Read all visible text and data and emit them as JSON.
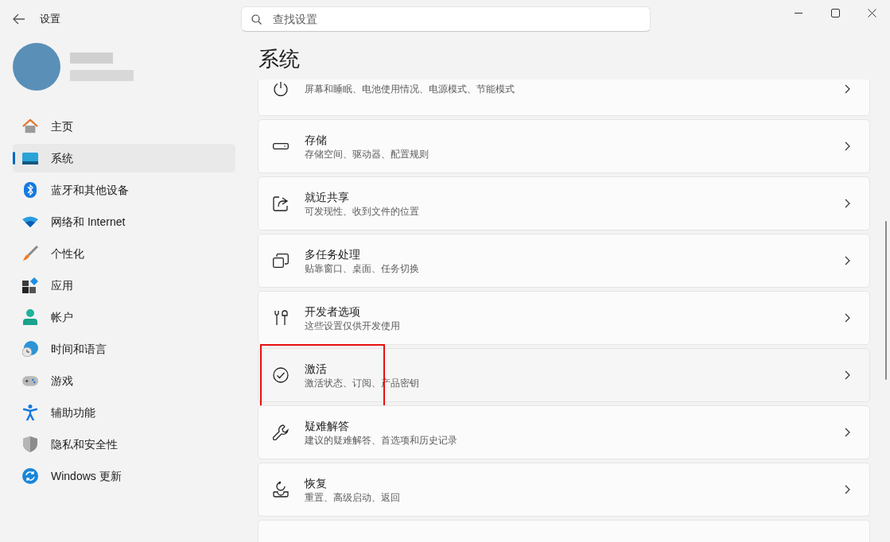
{
  "window": {
    "title": "设置"
  },
  "search": {
    "placeholder": "查找设置"
  },
  "sidebar": {
    "items": [
      {
        "label": "主页",
        "selected": false
      },
      {
        "label": "系统",
        "selected": true
      },
      {
        "label": "蓝牙和其他设备",
        "selected": false
      },
      {
        "label": "网络和 Internet",
        "selected": false
      },
      {
        "label": "个性化",
        "selected": false
      },
      {
        "label": "应用",
        "selected": false
      },
      {
        "label": "帐户",
        "selected": false
      },
      {
        "label": "时间和语言",
        "selected": false
      },
      {
        "label": "游戏",
        "selected": false
      },
      {
        "label": "辅助功能",
        "selected": false
      },
      {
        "label": "隐私和安全性",
        "selected": false
      },
      {
        "label": "Windows 更新",
        "selected": false
      }
    ]
  },
  "page": {
    "title": "系统"
  },
  "settings": [
    {
      "subtitle": "屏幕和睡眠、电池使用情况、电源模式、节能模式",
      "highlighted": false
    },
    {
      "title": "存储",
      "subtitle": "存储空间、驱动器、配置规则",
      "highlighted": false
    },
    {
      "title": "就近共享",
      "subtitle": "可发现性、收到文件的位置",
      "highlighted": false
    },
    {
      "title": "多任务处理",
      "subtitle": "贴靠窗口、桌面、任务切换",
      "highlighted": false
    },
    {
      "title": "开发者选项",
      "subtitle": "这些设置仅供开发使用",
      "highlighted": false
    },
    {
      "title": "激活",
      "subtitle": "激活状态、订阅、产品密钥",
      "highlighted": true
    },
    {
      "title": "疑难解答",
      "subtitle": "建议的疑难解答、首选项和历史记录",
      "highlighted": false
    },
    {
      "title": "恢复",
      "subtitle": "重置、高级启动、返回",
      "highlighted": false
    },
    {
      "highlighted": false
    }
  ]
}
